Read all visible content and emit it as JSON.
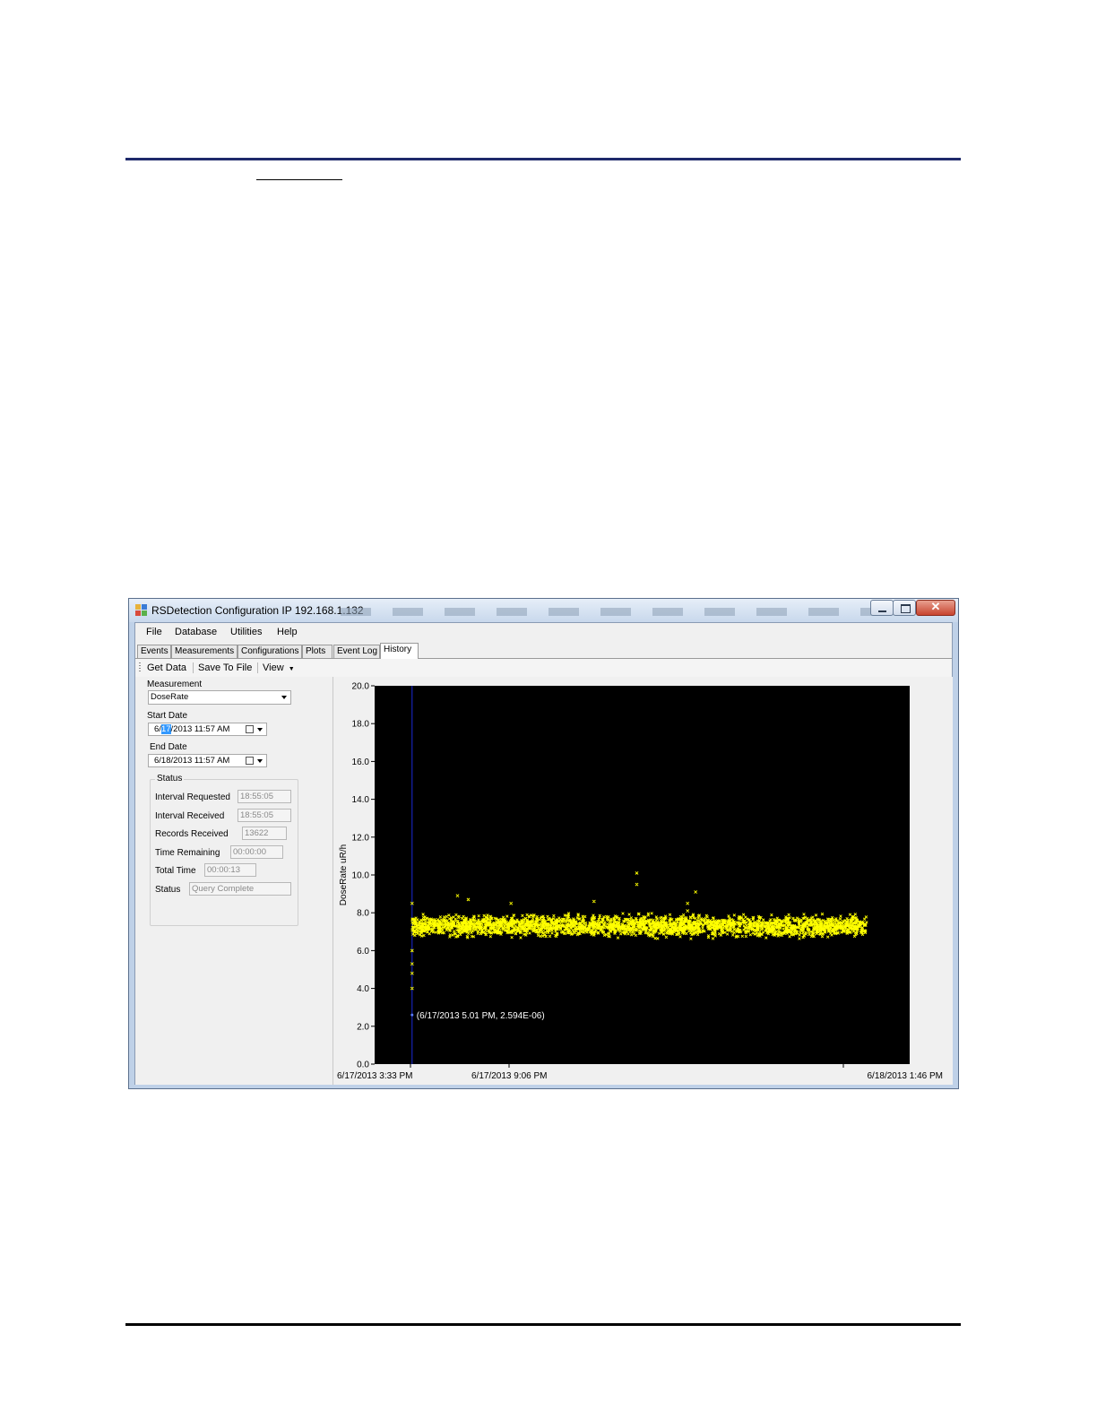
{
  "window": {
    "title": "RSDetection Configuration IP 192.168.1.132",
    "close_glyph": "✕"
  },
  "menu": [
    "File",
    "Database",
    "Utilities",
    "Help"
  ],
  "tabs": [
    {
      "label": "Events",
      "active": false
    },
    {
      "label": "Measurements",
      "active": false
    },
    {
      "label": "Configurations",
      "active": false
    },
    {
      "label": "Plots",
      "active": false
    },
    {
      "label": "Event Log",
      "active": false
    },
    {
      "label": "History",
      "active": true
    }
  ],
  "toolbar": {
    "get_data": "Get Data",
    "save_to_file": "Save To File",
    "view": "View"
  },
  "form": {
    "measurement_label": "Measurement",
    "measurement_value": "DoseRate",
    "start_date_label": "Start Date",
    "start_date_pre": "6/",
    "start_date_sel": "17",
    "start_date_post": "/2013 11:57 AM",
    "end_date_label": "End Date",
    "end_date_value": "6/18/2013 11:57 AM"
  },
  "status": {
    "group_label": "Status",
    "rows": [
      {
        "label": "Interval Requested",
        "value": "18:55:05"
      },
      {
        "label": "Interval Received",
        "value": "18:55:05"
      },
      {
        "label": "Records Received",
        "value": "13622"
      },
      {
        "label": "Time Remaining",
        "value": "00:00:00"
      },
      {
        "label": "Total Time",
        "value": "00:00:13"
      },
      {
        "label": "Status",
        "value": "Query Complete"
      }
    ]
  },
  "chart_data": {
    "type": "scatter",
    "ylabel": "DoseRate uR/h",
    "ylim": [
      0,
      20
    ],
    "yticks": [
      "0.0",
      "2.0",
      "4.0",
      "6.0",
      "8.0",
      "10.0",
      "12.0",
      "14.0",
      "16.0",
      "18.0",
      "20.0"
    ],
    "xtick_labels": [
      "6/17/2013 3:33 PM",
      "6/17/2013 9:06 PM",
      "6/18/2013 1:46 PM"
    ],
    "annotation": "(6/17/2013 5.01 PM, 2.594E-06)",
    "cursor_point": {
      "x_fraction": 0.07,
      "y": 2.6
    },
    "series": [
      {
        "color": "#ffff00",
        "marker": "x",
        "band_center": 7.3,
        "band_halfwidth": 0.7,
        "x_fraction_range": [
          0.07,
          0.92
        ],
        "outliers": [
          {
            "x_fraction": 0.07,
            "y": 6.0
          },
          {
            "x_fraction": 0.07,
            "y": 5.3
          },
          {
            "x_fraction": 0.07,
            "y": 4.8
          },
          {
            "x_fraction": 0.07,
            "y": 4.0
          },
          {
            "x_fraction": 0.07,
            "y": 8.5
          },
          {
            "x_fraction": 0.155,
            "y": 8.9
          },
          {
            "x_fraction": 0.175,
            "y": 8.7
          },
          {
            "x_fraction": 0.255,
            "y": 8.5
          },
          {
            "x_fraction": 0.41,
            "y": 8.6
          },
          {
            "x_fraction": 0.49,
            "y": 10.1
          },
          {
            "x_fraction": 0.49,
            "y": 9.5
          },
          {
            "x_fraction": 0.585,
            "y": 8.5
          },
          {
            "x_fraction": 0.6,
            "y": 9.1
          },
          {
            "x_fraction": 0.585,
            "y": 8.1
          }
        ]
      }
    ],
    "background": "#000000",
    "cursor_color": "#1a2bd6"
  }
}
